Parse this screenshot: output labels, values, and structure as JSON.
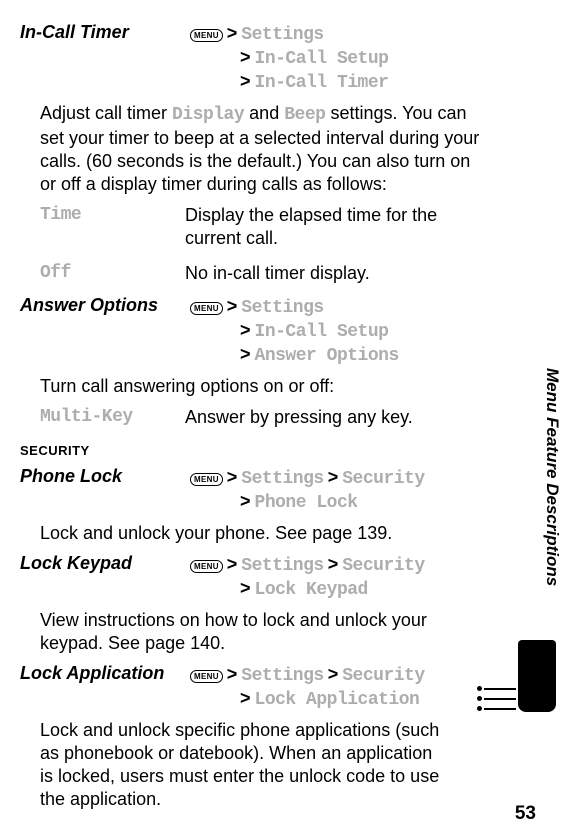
{
  "menuLabel": "MENU",
  "sideTab": "Menu Feature Descriptions",
  "pageNumber": "53",
  "sectionHeading": "SECURITY",
  "features": {
    "inCallTimer": {
      "title": "In-Call Timer",
      "path1": "Settings",
      "path2": "In-Call Setup",
      "path3": "In-Call Timer",
      "body": "Adjust call timer Display and Beep settings. You can set your timer to beep at a selected interval during your calls. (60 seconds is the default.) You can also turn on or off a display timer during calls as follows:",
      "bodyPrefix": "Adjust call timer ",
      "bodyMono1": "Display",
      "bodyMid": " and ",
      "bodyMono2": "Beep",
      "bodySuffix": " settings. You can set your timer to beep at a selected interval during your calls. (60 seconds is the default.) You can also turn on or off a display timer during calls as follows:",
      "rows": {
        "time": {
          "term": "Time",
          "desc": "Display the elapsed time for the current call."
        },
        "off": {
          "term": "Off",
          "desc": "No in-call timer display."
        }
      }
    },
    "answerOptions": {
      "title": "Answer Options",
      "path1": "Settings",
      "path2": "In-Call Setup",
      "path3": "Answer Options",
      "body": "Turn call answering options on or off:",
      "rows": {
        "multiKey": {
          "term": "Multi-Key",
          "desc": "Answer by pressing any key."
        }
      }
    },
    "phoneLock": {
      "title": "Phone Lock",
      "path1": "Settings",
      "path2": "Security",
      "path3": "Phone Lock",
      "body": "Lock and unlock your phone. See page 139."
    },
    "lockKeypad": {
      "title": "Lock Keypad",
      "path1": "Settings",
      "path2": "Security",
      "path3": "Lock Keypad",
      "body": "View instructions on how to lock and unlock your keypad. See page 140."
    },
    "lockApplication": {
      "title": "Lock Application",
      "path1": "Settings",
      "path2": "Security",
      "path3": "Lock Application",
      "body": "Lock and unlock specific phone applications (such as phonebook or datebook). When an application is locked, users must enter the unlock code to use the application."
    }
  }
}
